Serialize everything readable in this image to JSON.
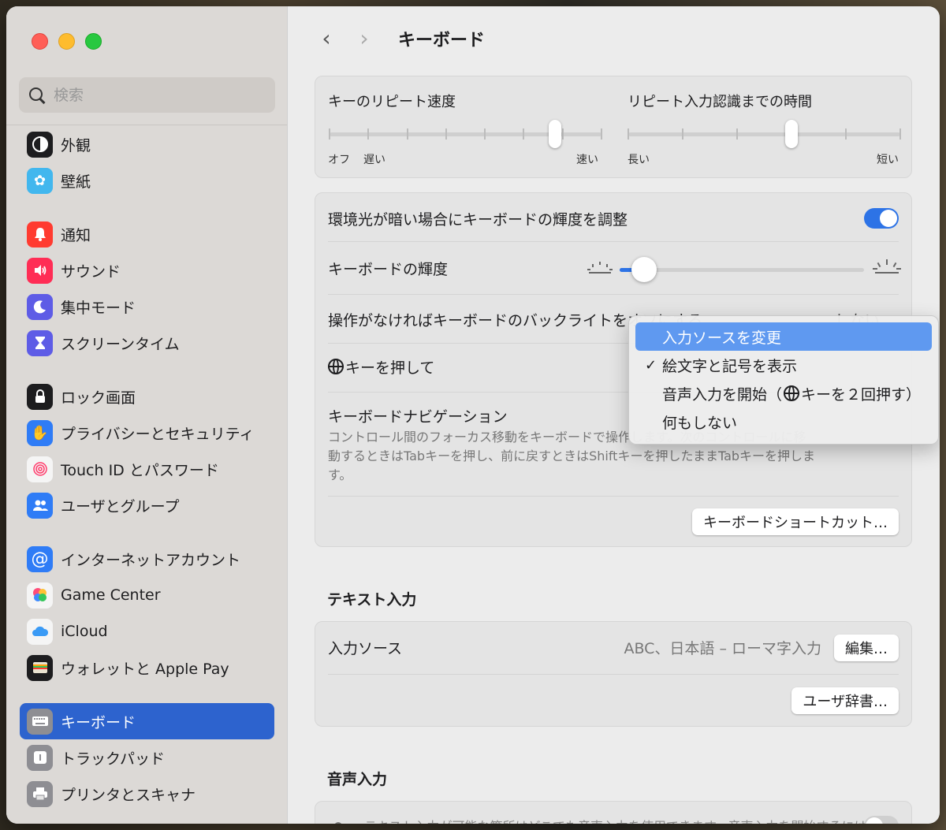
{
  "sidebar": {
    "search_placeholder": "検索",
    "items": [
      {
        "label": "外観",
        "icon": "appearance-icon",
        "color": "#1d1d1f"
      },
      {
        "label": "壁紙",
        "icon": "wallpaper-icon",
        "color": "#42b7ee"
      },
      {
        "label": "通知",
        "icon": "notifications-icon",
        "color": "#ff3b30"
      },
      {
        "label": "サウンド",
        "icon": "sound-icon",
        "color": "#ff2d55"
      },
      {
        "label": "集中モード",
        "icon": "focus-moon-icon",
        "color": "#5e5ce6"
      },
      {
        "label": "スクリーンタイム",
        "icon": "hourglass-icon",
        "color": "#5e5ce6"
      },
      {
        "label": "ロック画面",
        "icon": "lock-icon",
        "color": "#1d1d1f"
      },
      {
        "label": "プライバシーとセキュリティ",
        "icon": "hand-icon",
        "color": "#2f7cf6"
      },
      {
        "label": "Touch ID とパスワード",
        "icon": "fingerprint-icon",
        "color": "#f5f5f5"
      },
      {
        "label": "ユーザとグループ",
        "icon": "users-icon",
        "color": "#2f7cf6"
      },
      {
        "label": "インターネットアカウント",
        "icon": "at-icon",
        "color": "#2f7cf6"
      },
      {
        "label": "Game Center",
        "icon": "game-center-icon",
        "color": "#f5f5f5"
      },
      {
        "label": "iCloud",
        "icon": "icloud-icon",
        "color": "#f5f5f5"
      },
      {
        "label": "ウォレットと Apple Pay",
        "icon": "wallet-icon",
        "color": "#1d1d1f"
      },
      {
        "label": "キーボード",
        "icon": "keyboard-icon",
        "color": "#8e8e93"
      },
      {
        "label": "トラックパッド",
        "icon": "trackpad-icon",
        "color": "#8e8e93"
      },
      {
        "label": "プリンタとスキャナ",
        "icon": "printer-icon",
        "color": "#8e8e93"
      }
    ]
  },
  "header": {
    "title": "キーボード",
    "back_glyph": "‹",
    "forward_glyph": "›"
  },
  "key_repeat": {
    "label": "キーのリピート速度",
    "min_labels": [
      "オフ",
      "遅い"
    ],
    "max_label": "速い",
    "value_fraction": 0.83
  },
  "delay_until_repeat": {
    "label": "リピート入力認識までの時間",
    "min_label": "長い",
    "max_label": "短い",
    "value_fraction": 0.6
  },
  "backlight": {
    "auto_brightness_label": "環境光が暗い場合にキーボードの輝度を調整",
    "auto_brightness_on": true,
    "brightness_label": "キーボードの輝度",
    "brightness_fraction": 0.1,
    "turn_off_label": "操作がなければキーボードのバックライトをオフにする",
    "turn_off_value": "しない",
    "globe_key_label": "キーを押して",
    "navigation_label": "キーボードナビゲーション",
    "navigation_desc": "コントロール間のフォーカス移動をキーボードで操作します。次のコントロールに移動するときはTabキーを押し、前に戻すときはShiftキーを押したままTabキーを押します。",
    "shortcuts_button": "キーボードショートカット…"
  },
  "text_input": {
    "section_title": "テキスト入力",
    "input_sources_label": "入力ソース",
    "input_sources_value": "ABC、日本語 – ローマ字入力",
    "edit_button": "編集…",
    "user_dict_button": "ユーザ辞書…"
  },
  "dictation": {
    "section_title": "音声入力",
    "desc": "テキスト入力が可能な箇所はどこでも音声入力を使用できます。音声入力を開始するには",
    "enabled": false
  },
  "globe_menu": {
    "items": [
      {
        "label": "入力ソースを変更",
        "highlighted": true,
        "checked": false
      },
      {
        "label": "絵文字と記号を表示",
        "highlighted": false,
        "checked": true
      },
      {
        "label_before": "音声入力を開始（",
        "label_after": "キーを２回押す）",
        "highlighted": false,
        "checked": false
      },
      {
        "label": "何もしない",
        "highlighted": false,
        "checked": false
      }
    ]
  }
}
